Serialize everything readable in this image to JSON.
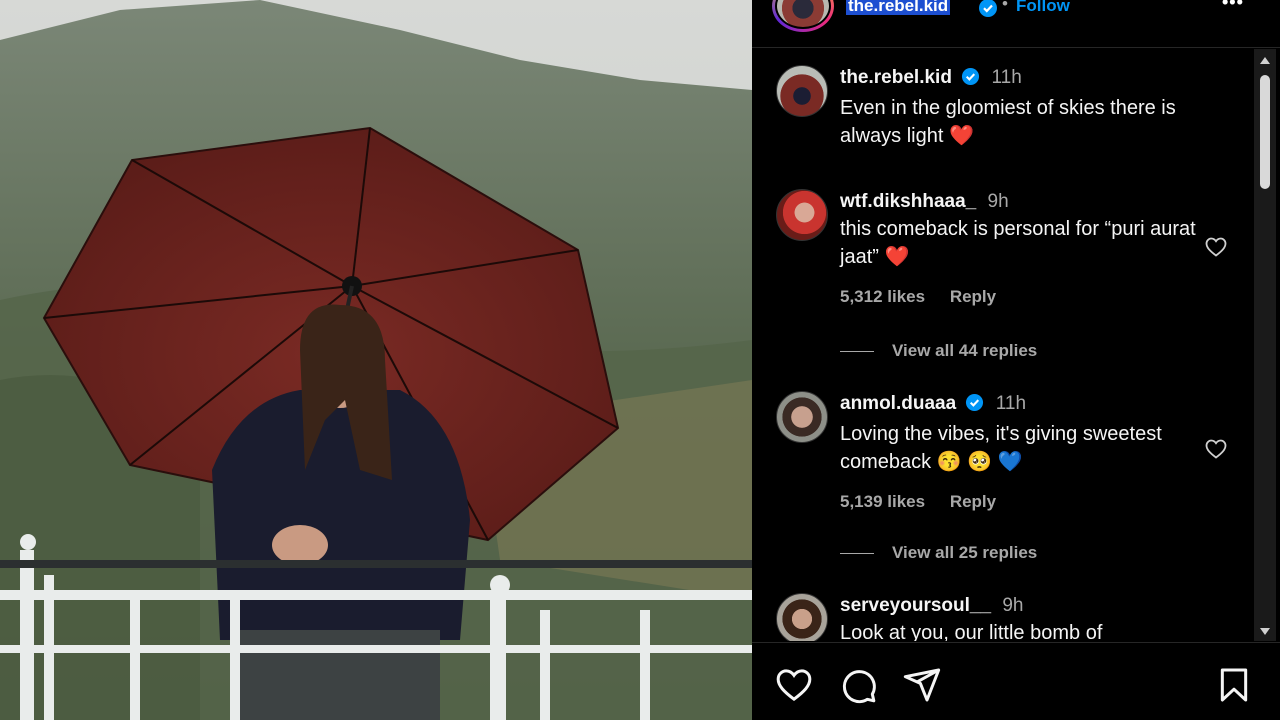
{
  "header": {
    "username": "the.rebel.kid",
    "separator": "•",
    "follow_label": "Follow",
    "more_icon": "more-horizontal-icon"
  },
  "colors": {
    "accent": "#0095f6",
    "verified": "#0095f6",
    "background": "#000000",
    "muted_text": "#a8a8a8",
    "heart_red": "#ff3040"
  },
  "comments": [
    {
      "username": "the.rebel.kid",
      "verified": true,
      "time": "11h",
      "text": "Even in the gloomiest of skies there is always light",
      "emoji": "❤️"
    },
    {
      "username": "wtf.dikshhaaa_",
      "verified": false,
      "time": "9h",
      "text": "this comeback is personal for “puri aurat jaat”",
      "emoji": "❤️",
      "likes": "5,312 likes",
      "reply_label": "Reply",
      "view_replies": "View all 44 replies"
    },
    {
      "username": "anmol.duaaa",
      "verified": true,
      "time": "11h",
      "text": "Loving the vibes, it's giving sweetest comeback",
      "emoji": "😚 🥺 💙",
      "likes": "5,139 likes",
      "reply_label": "Reply",
      "view_replies": "View all 25 replies"
    },
    {
      "username": "serveyoursoul__",
      "verified": false,
      "time": "9h",
      "text": "Look at you, our little bomb of"
    }
  ],
  "actions": {
    "like_icon": "heart-icon",
    "comment_icon": "comment-icon",
    "share_icon": "send-icon",
    "save_icon": "bookmark-icon"
  }
}
